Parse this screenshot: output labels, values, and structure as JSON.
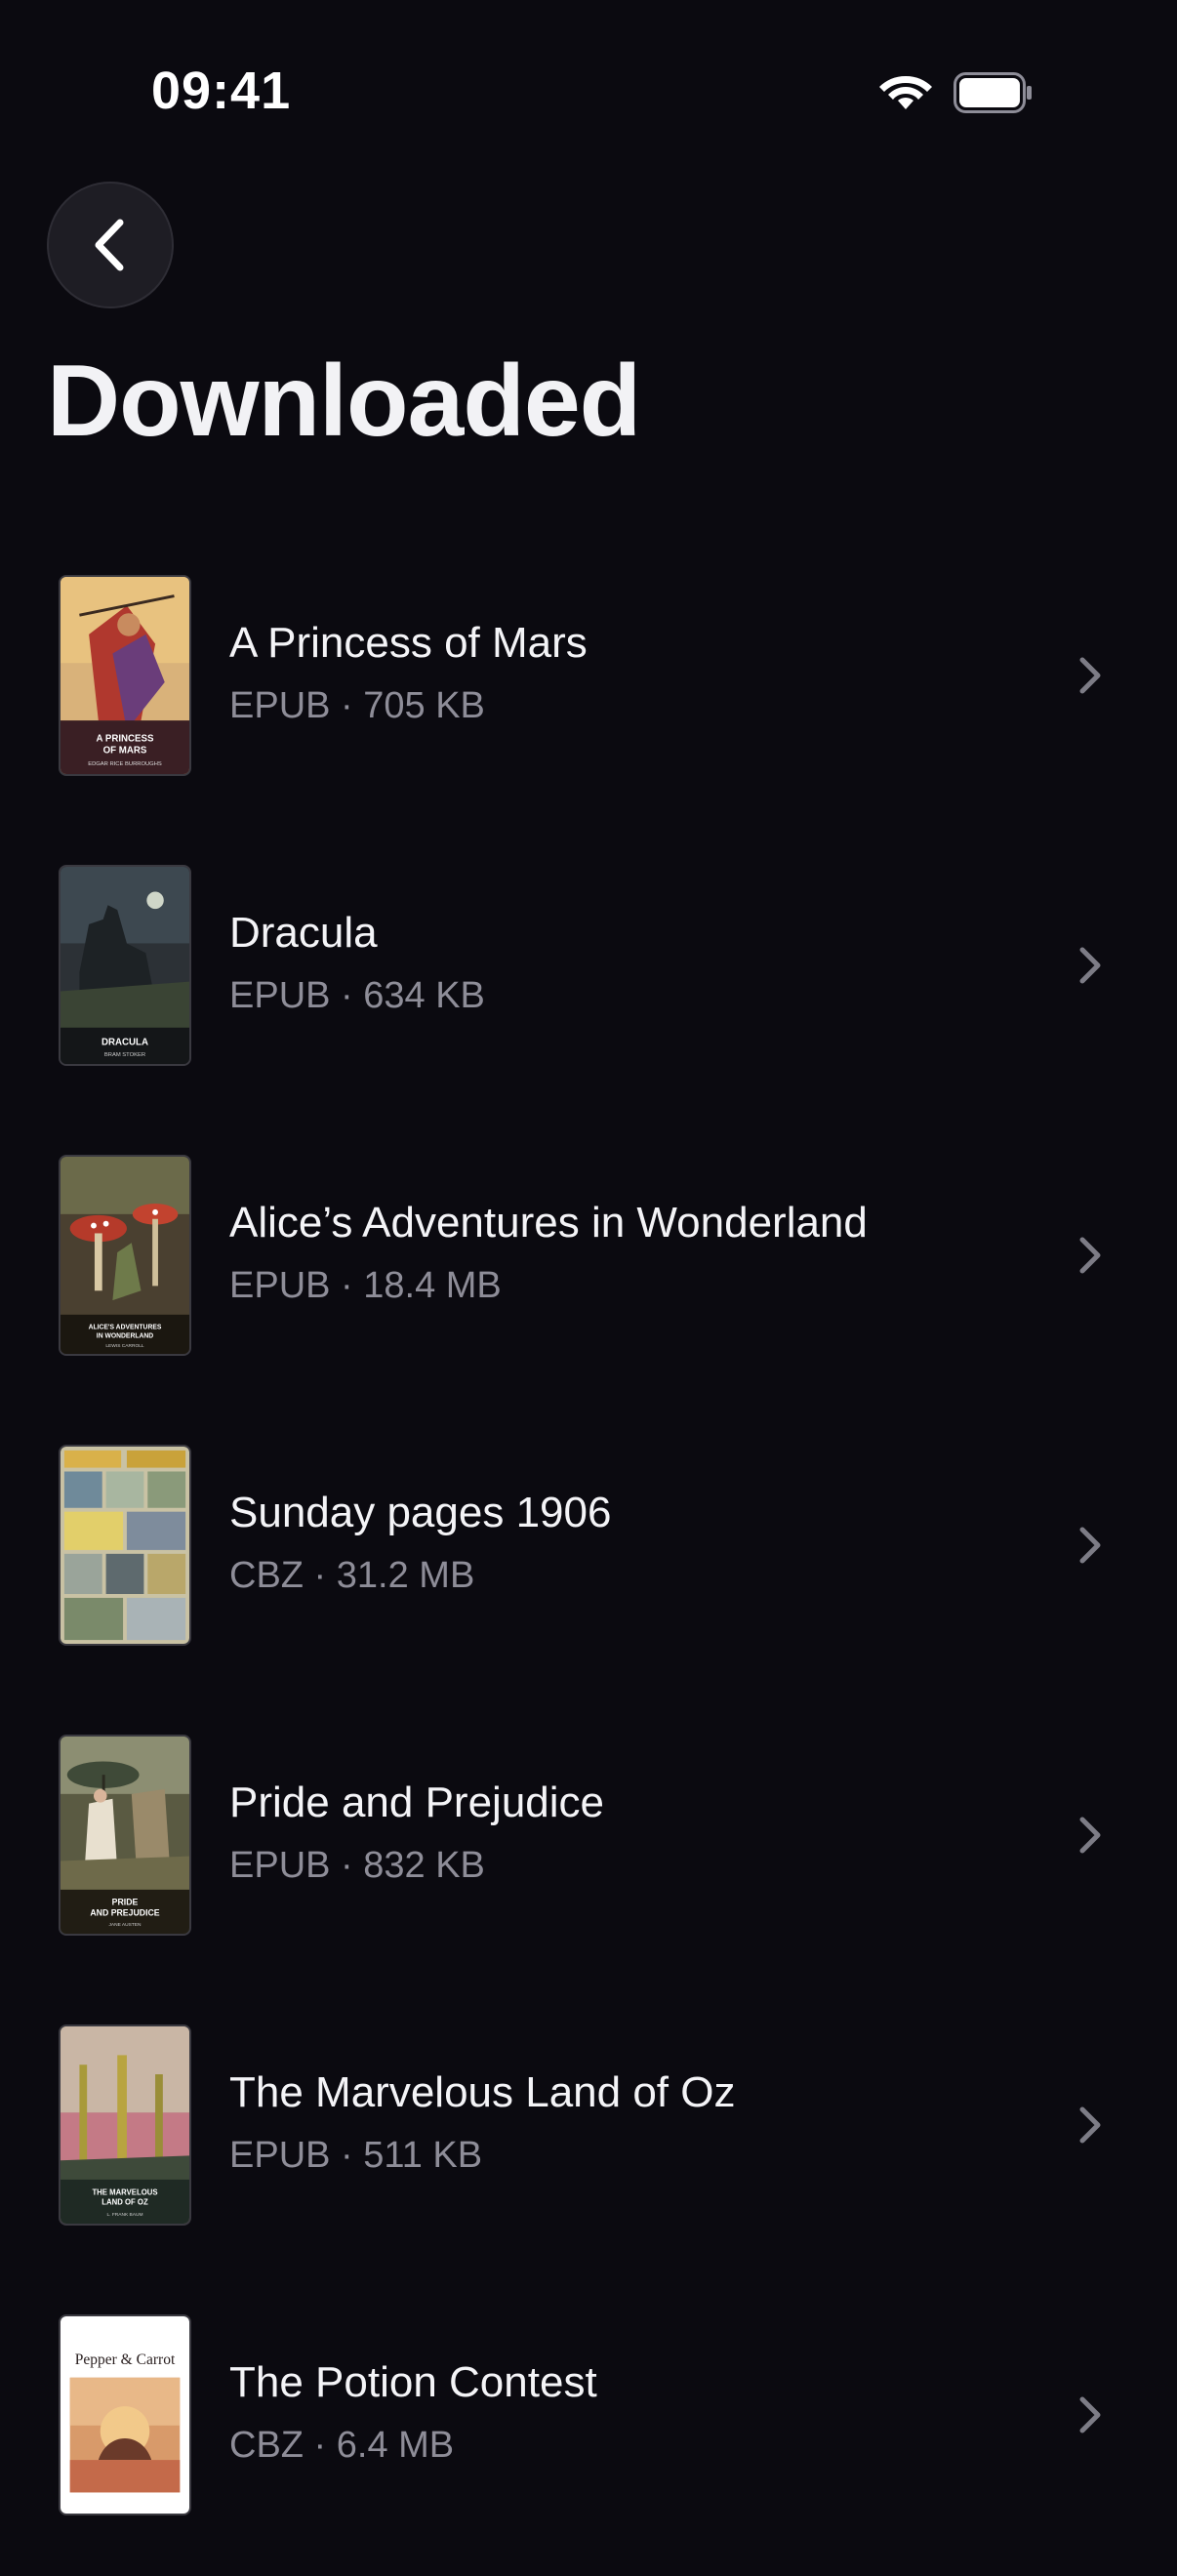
{
  "status_bar": {
    "time": "09:41",
    "wifi_icon": "wifi-icon",
    "battery_icon": "battery-icon"
  },
  "header": {
    "back_icon": "chevron-left-icon",
    "title": "Downloaded"
  },
  "books": [
    {
      "title": "A Princess of Mars",
      "meta": "EPUB · 705 KB",
      "cover_title": "A PRINCESS OF MARS",
      "cover_author": "EDGAR RICE BURROUGHS"
    },
    {
      "title": "Dracula",
      "meta": "EPUB · 634 KB",
      "cover_title": "DRACULA",
      "cover_author": "BRAM STOKER"
    },
    {
      "title": "Alice’s Adventures in Wonderland",
      "meta": "EPUB · 18.4 MB",
      "cover_title": "ALICE'S ADVENTURES IN WONDERLAND",
      "cover_author": "LEWIS CARROLL"
    },
    {
      "title": "Sunday pages 1906",
      "meta": "CBZ · 31.2 MB"
    },
    {
      "title": "Pride and Prejudice",
      "meta": "EPUB · 832 KB",
      "cover_title": "PRIDE AND PREJUDICE",
      "cover_author": "JANE AUSTEN"
    },
    {
      "title": "The Marvelous Land of Oz",
      "meta": "EPUB · 511 KB",
      "cover_title": "THE MARVELOUS LAND OF OZ",
      "cover_author": "L. FRANK BAUM"
    },
    {
      "title": "The Potion Contest",
      "meta": "CBZ · 6.4 MB",
      "cover_title": "Pepper & Carrot"
    }
  ],
  "colors": {
    "background": "#0b0a10",
    "meta_text": "#8e8d98",
    "chevron": "#7d7c86"
  }
}
